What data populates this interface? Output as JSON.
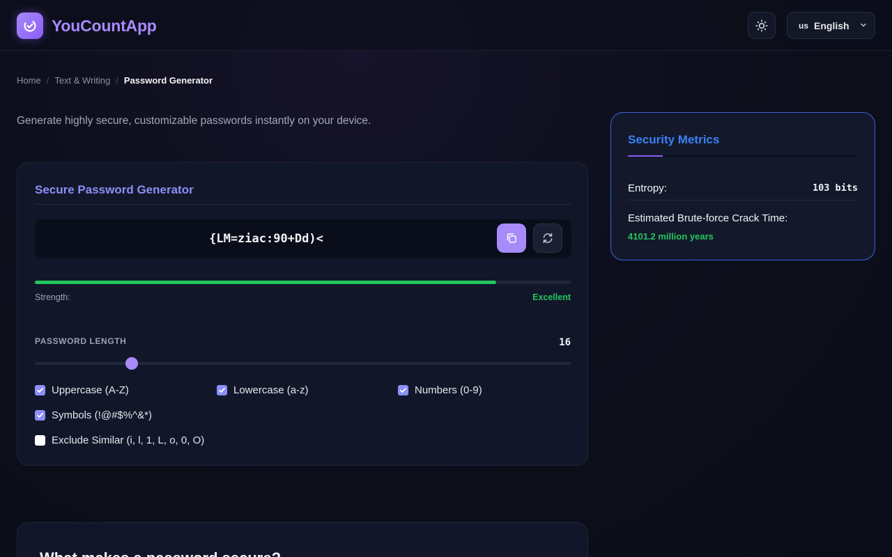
{
  "app": {
    "name": "YouCountApp"
  },
  "header": {
    "theme_icon": "sun-icon",
    "language": {
      "flag": "us",
      "label": "English"
    }
  },
  "breadcrumb": {
    "home": "Home",
    "category": "Text & Writing",
    "current": "Password Generator"
  },
  "intro": "Generate highly secure, customizable passwords instantly on your device.",
  "generator": {
    "title": "Secure Password Generator",
    "password": "{LM=ziac:90+Dd)<",
    "strength": {
      "label": "Strength:",
      "value": "Excellent",
      "percent": 86
    },
    "length": {
      "label": "PASSWORD LENGTH",
      "value": "16",
      "slider_fraction": 0.18
    },
    "options": {
      "uppercase": {
        "label": "Uppercase (A-Z)",
        "checked": true
      },
      "lowercase": {
        "label": "Lowercase (a-z)",
        "checked": true
      },
      "numbers": {
        "label": "Numbers (0-9)",
        "checked": true
      },
      "symbols": {
        "label": "Symbols (!@#$%^&*)",
        "checked": true
      },
      "exclude_similar": {
        "label": "Exclude Similar (i, l, 1, L, o, 0, O)",
        "checked": false
      }
    }
  },
  "metrics": {
    "title": "Security Metrics",
    "entropy_label": "Entropy:",
    "entropy_value": "103 bits",
    "crack_label": "Estimated Brute-force Crack Time:",
    "crack_value": "4101.2 million years"
  },
  "info": {
    "title": "What makes a password secure?"
  },
  "colors": {
    "accent": "#a78bfa",
    "success": "#22c55e",
    "metrics_title": "#3b82f6"
  }
}
